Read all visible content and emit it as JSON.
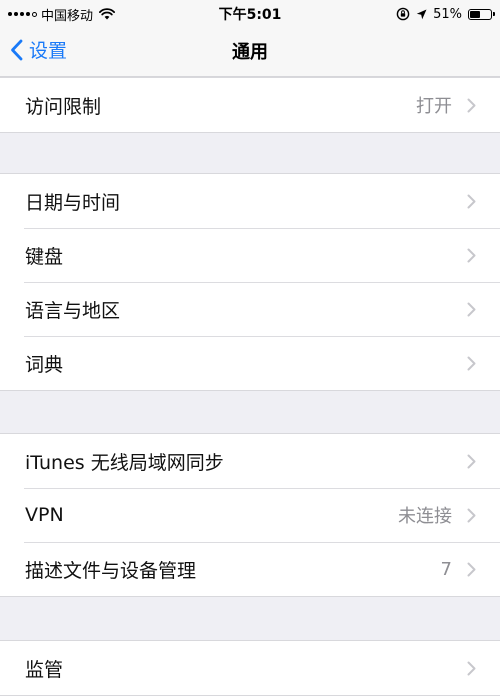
{
  "status_bar": {
    "carrier": "中国移动",
    "time": "下午5:01",
    "battery": "51%",
    "battery_level": 0.51,
    "signal_bars": 4
  },
  "nav": {
    "back_label": "设置",
    "title": "通用"
  },
  "groups": [
    {
      "cells": [
        {
          "label": "访问限制",
          "value": "打开"
        }
      ]
    },
    {
      "cells": [
        {
          "label": "日期与时间",
          "value": ""
        },
        {
          "label": "键盘",
          "value": ""
        },
        {
          "label": "语言与地区",
          "value": ""
        },
        {
          "label": "词典",
          "value": ""
        }
      ]
    },
    {
      "cells": [
        {
          "label": "iTunes 无线局域网同步",
          "value": ""
        },
        {
          "label": "VPN",
          "value": "未连接"
        },
        {
          "label": "描述文件与设备管理",
          "value": "7"
        }
      ]
    },
    {
      "cells": [
        {
          "label": "监管",
          "value": ""
        }
      ]
    }
  ],
  "colors": {
    "accent": "#1a7af8",
    "background": "#efeff4",
    "secondary_text": "#8e8e93",
    "chevron": "#c7c7cc"
  }
}
